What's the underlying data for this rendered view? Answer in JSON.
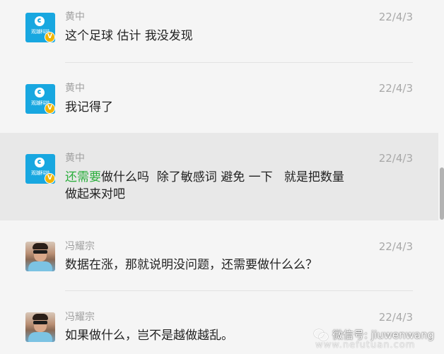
{
  "brand_avatar_text": "观潮科技",
  "messages": [
    {
      "name": "黄中",
      "date": "22/4/3",
      "avatar": "brand",
      "badge": "V",
      "parts": [
        {
          "text": "这个足球 估计 我没发现",
          "highlight": false
        }
      ]
    },
    {
      "name": "黄中",
      "date": "22/4/3",
      "avatar": "brand",
      "badge": "V",
      "parts": [
        {
          "text": "我记得了",
          "highlight": false
        }
      ]
    },
    {
      "name": "黄中",
      "date": "22/4/3",
      "avatar": "brand",
      "badge": "V",
      "highlighted_row": true,
      "parts": [
        {
          "text": "还需要",
          "highlight": true
        },
        {
          "text": "做什么吗  除了敏感词 避免 一下   就是把数量做起来对吧",
          "highlight": false
        }
      ]
    },
    {
      "name": "冯耀宗",
      "date": "22/4/3",
      "avatar": "photo",
      "parts": [
        {
          "text": "数据在涨，那就说明没问题，还需要做什么么？",
          "highlight": false
        }
      ]
    },
    {
      "name": "冯耀宗",
      "date": "22/4/3",
      "avatar": "photo",
      "parts": [
        {
          "text": "如果做什么，岂不是越做越乱。",
          "highlight": false
        }
      ]
    }
  ],
  "watermark": {
    "label": "微信号: jiuwenwang",
    "sub": "www.nefutuan.com"
  },
  "colors": {
    "highlight_text": "#2aae3b",
    "row_highlight_bg": "#e8e8e8",
    "badge": "#f0b400",
    "brand_avatar": "#18a7e0"
  }
}
